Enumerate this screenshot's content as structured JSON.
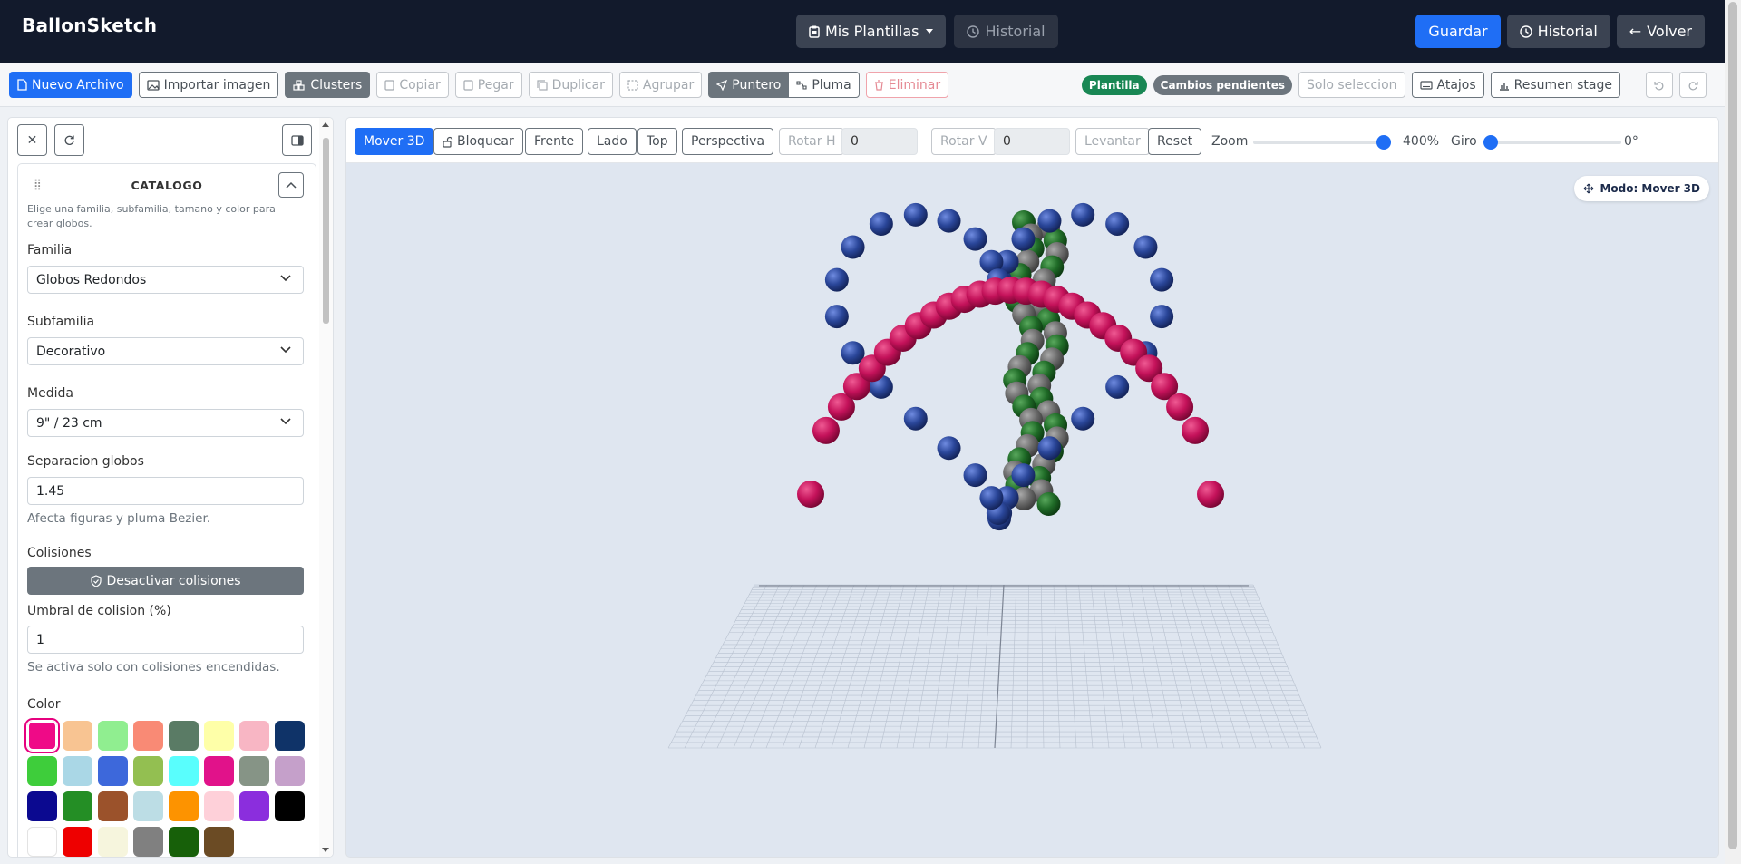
{
  "app": {
    "brand": "BallonSketch"
  },
  "nav": {
    "templates": "Mis Plantillas",
    "history_disabled": "Historial",
    "save": "Guardar",
    "history": "Historial",
    "back": "Volver"
  },
  "toolbar": {
    "new_file": "Nuevo Archivo",
    "import_image": "Importar imagen",
    "clusters": "Clusters",
    "copy": "Copiar",
    "paste": "Pegar",
    "duplicate": "Duplicar",
    "group": "Agrupar",
    "pointer": "Puntero",
    "pen": "Pluma",
    "delete": "Eliminar",
    "badge_template": "Plantilla",
    "badge_changes": "Cambios pendientes",
    "only_selection": "Solo seleccion",
    "shortcuts": "Atajos",
    "stage_summary": "Resumen stage"
  },
  "catalog": {
    "title": "CATALOGO",
    "hint": "Elige una familia, subfamilia, tamano y color para crear globos.",
    "family_label": "Familia",
    "family_value": "Globos Redondos",
    "subfamily_label": "Subfamilia",
    "subfamily_value": "Decorativo",
    "size_label": "Medida",
    "size_value": "9\" / 23 cm",
    "separation_label": "Separacion globos",
    "separation_value": "1.45",
    "separation_help": "Afecta figuras y pluma Bezier.",
    "collisions_label": "Colisiones",
    "collisions_button": "Desactivar colisiones",
    "threshold_label": "Umbral de colision (%)",
    "threshold_value": "1",
    "threshold_help": "Se activa solo con colisiones encendidas.",
    "color_label": "Color",
    "swatches": [
      "#ef0a87",
      "#f8c492",
      "#90ee90",
      "#f98a75",
      "#5a7b65",
      "#feffa8",
      "#f8b6c4",
      "#0f3368",
      "#3ecd3b",
      "#aad7e6",
      "#3d68db",
      "#93bf51",
      "#59fefd",
      "#e1128a",
      "#869486",
      "#c5a0ca",
      "#0b0990",
      "#248e25",
      "#9b522b",
      "#bcdde5",
      "#fd9300",
      "#fed0d9",
      "#8b2edd",
      "#000000",
      "#ffffff",
      "#ee0000",
      "#f6f5dd",
      "#808080",
      "#176009",
      "#6b4b24"
    ]
  },
  "viewport": {
    "move3d": "Mover 3D",
    "lock": "Bloquear",
    "front": "Frente",
    "side": "Lado",
    "top": "Top",
    "perspective": "Perspectiva",
    "rot_h": "Rotar H",
    "rot_h_value": "0",
    "rot_v": "Rotar V",
    "rot_v_value": "0",
    "lift": "Levantar",
    "reset": "Reset",
    "zoom_label": "Zoom",
    "zoom_value": "400%",
    "zoom_level": 1.0,
    "turn_label": "Giro",
    "turn_value": "0°",
    "turn_level": 0.0,
    "mode": "Modo: Mover 3D"
  },
  "colors": {
    "heart": "#2a4699",
    "arch": "#c4125a",
    "column_green": "#1f6b27",
    "column_gray": "#6b6b6b",
    "accent": "#1f6ef5"
  }
}
